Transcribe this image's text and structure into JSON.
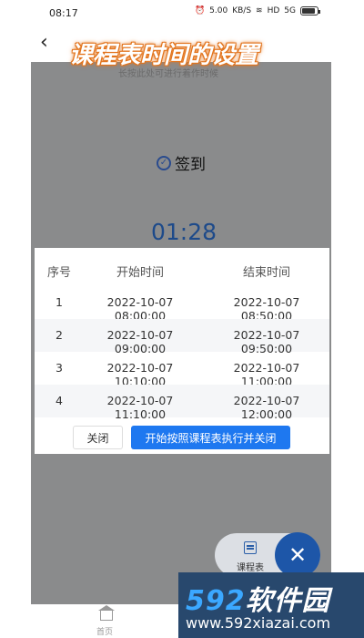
{
  "status_bar": {
    "time": "08:17",
    "speed": "5.00",
    "speed_unit": "KB/S",
    "wifi": "wifi",
    "hd": "HD",
    "signal": "5G",
    "battery_level": 85
  },
  "overlay_title": "课程表时间的设置",
  "faded_hint": "长按此处可进行着作时候",
  "sign": {
    "label": "签到"
  },
  "timer": "01:28",
  "table": {
    "headers": [
      "序号",
      "开始时间",
      "结束时间"
    ],
    "rows": [
      {
        "index": "1",
        "start": "2022-10-07 08:00:00",
        "end": "2022-10-07 08:50:00"
      },
      {
        "index": "2",
        "start": "2022-10-07 09:00:00",
        "end": "2022-10-07 09:50:00"
      },
      {
        "index": "3",
        "start": "2022-10-07 10:10:00",
        "end": "2022-10-07 11:00:00"
      },
      {
        "index": "4",
        "start": "2022-10-07 11:10:00",
        "end": "2022-10-07 12:00:00"
      }
    ]
  },
  "buttons": {
    "close": "关闭",
    "start": "开始按照课程表执行并关闭"
  },
  "fab": {
    "schedule_label": "课程表",
    "close_glyph": "✕"
  },
  "bottom_nav": {
    "home_label": "首页"
  },
  "watermark": {
    "num": "592",
    "text": "软件园",
    "url": "www.592xiazai.com"
  },
  "colors": {
    "accent": "#1e78f0",
    "fab": "#1d56a8",
    "overlay_bg": "#8a8b8c"
  }
}
